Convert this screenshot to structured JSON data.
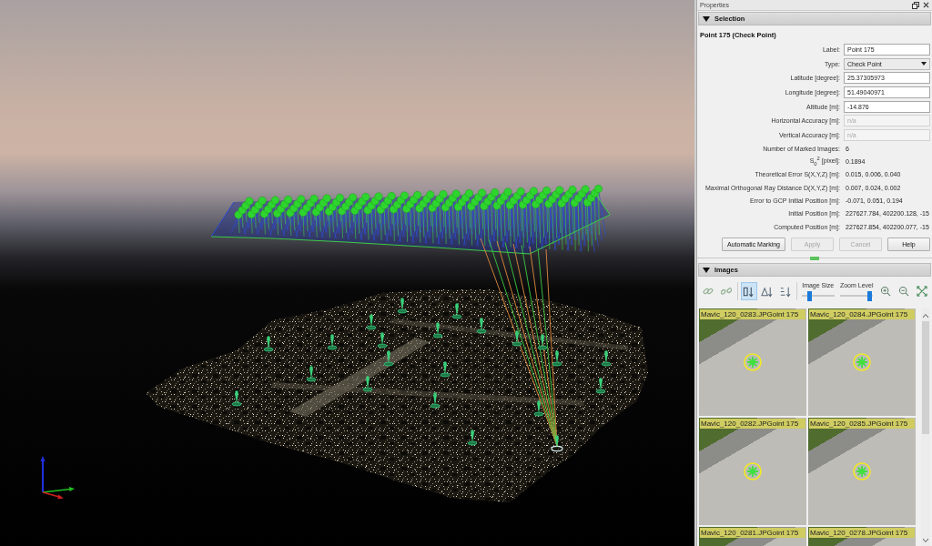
{
  "panel": {
    "title": "Properties"
  },
  "selection": {
    "header": "Selection",
    "expanded": true,
    "title": "Point 175 (Check Point)",
    "fields": [
      {
        "label": "Label:",
        "kind": "input",
        "value": "Point 175",
        "disabled": false
      },
      {
        "label": "Type:",
        "kind": "dropdown",
        "value": "Check Point",
        "disabled": false
      },
      {
        "label": "Latitude [degree]:",
        "kind": "input",
        "value": "25.37305973",
        "disabled": false
      },
      {
        "label": "Longitude [degree]:",
        "kind": "input",
        "value": "51.49040971",
        "disabled": false
      },
      {
        "label": "Altitude [m]:",
        "kind": "input",
        "value": "-14.876",
        "disabled": false
      },
      {
        "label": "Horizontal Accuracy [m]:",
        "kind": "input",
        "value": "n/a",
        "disabled": true
      },
      {
        "label": "Vertical Accuracy [m]:",
        "kind": "input",
        "value": "n/a",
        "disabled": true
      },
      {
        "label": "Number of Marked Images:",
        "kind": "text",
        "value": "6",
        "disabled": false
      },
      {
        "label": "S$_{0}$$^{2}$ [pixel]:",
        "kind": "text",
        "value": "0.1894",
        "disabled": false
      },
      {
        "label": "Theoretical Error S(X,Y,Z) [m]:",
        "kind": "text",
        "value": "0.015, 0.006, 0.040",
        "disabled": false
      },
      {
        "label": "Maximal Orthogonal Ray Distance D(X,Y,Z) [m]:",
        "kind": "text",
        "value": "0.007, 0.024, 0.002",
        "disabled": false
      },
      {
        "label": "Error to GCP Initial Position [m]:",
        "kind": "text",
        "value": "-0.071, 0.051, 0.194",
        "disabled": false
      },
      {
        "label": "Initial Position [m]:",
        "kind": "text",
        "value": "227627.784, 402200.128, -15",
        "disabled": false
      },
      {
        "label": "Computed Position [m]:",
        "kind": "text",
        "value": "227627.854, 402200.077, -15",
        "disabled": false
      }
    ],
    "buttons": [
      {
        "label": "Automatic Marking",
        "disabled": false
      },
      {
        "label": "Apply",
        "disabled": true
      },
      {
        "label": "Cancel",
        "disabled": true
      },
      {
        "label": "Help",
        "disabled": false
      }
    ]
  },
  "images": {
    "header": "Images",
    "expanded": true,
    "link_tools": [
      {
        "kind": "link"
      },
      {
        "kind": "unlink"
      }
    ],
    "sort_tools": [
      {
        "kind": "marked",
        "selected": true
      },
      {
        "kind": "delta",
        "selected": false
      },
      {
        "kind": "alpha",
        "selected": false
      }
    ],
    "sliders": [
      {
        "label": "Image Size",
        "level": 0.2
      },
      {
        "label": "Zoom Level",
        "level": 0.95
      }
    ],
    "zoom_tools": [
      {
        "kind": "zoom_in"
      },
      {
        "kind": "zoom_out"
      },
      {
        "kind": "fit"
      }
    ],
    "thumbnails": [
      {
        "file": "Mavic_120_0283.JPG",
        "point": "oint 175"
      },
      {
        "file": "Mavic_120_0284.JPG",
        "point": "oint 175"
      },
      {
        "file": "Mavic_120_0282.JPG",
        "point": "oint 175"
      },
      {
        "file": "Mavic_120_0285.JPG",
        "point": "oint 175"
      },
      {
        "file": "Mavic_120_0281.JPG",
        "point": "oint 175"
      },
      {
        "file": "Mavic_120_0278.JPG",
        "point": "oint 175"
      }
    ]
  }
}
